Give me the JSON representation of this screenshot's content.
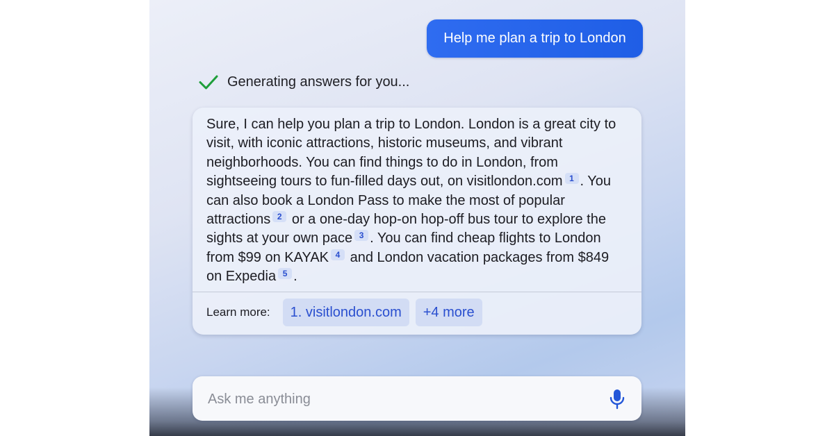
{
  "conversation": {
    "user_message": "Help me plan a trip to London",
    "status_text": "Generating answers for you...",
    "answer": {
      "s1": "Sure, I can help you plan a trip to London. London is a great city to visit, with iconic attractions, historic museums, and vibrant neighborhoods. You can find things to do in London, from sightseeing tours to fun-filled days out, on visitlondon.com",
      "c1": "1",
      "s2": ". You can also book a London Pass to make the most of popular attractions",
      "c2": "2",
      "s3": " or a one-day hop-on hop-off bus tour to explore the sights at your own pace",
      "c3": "3",
      "s4": ". You can find cheap flights to London from $99 on KAYAK",
      "c4": "4",
      "s5": " and London vacation packages from $849 on Expedia",
      "c5": "5",
      "s6": "."
    },
    "learn_more": {
      "label": "Learn more:",
      "links": [
        "1. visitlondon.com",
        "+4 more"
      ]
    }
  },
  "input": {
    "placeholder": "Ask me anything"
  },
  "icons": {
    "status": "check-icon",
    "input_action": "microphone-icon"
  },
  "colors": {
    "accent": "#1f5ee6",
    "check": "#1e9e3a",
    "link": "#2a4fcf",
    "chip_bg": "#d2dcf4"
  }
}
